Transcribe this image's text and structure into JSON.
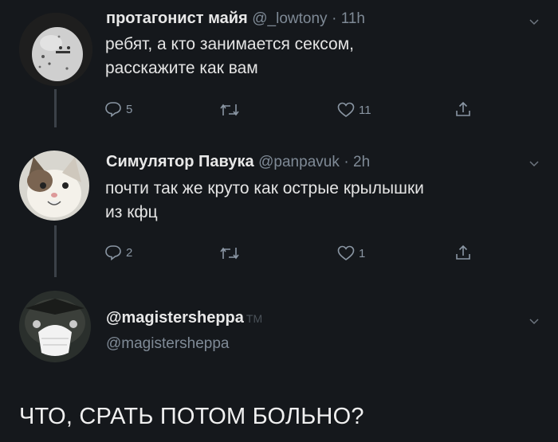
{
  "tweets": [
    {
      "name": "протагонист майя",
      "handle": "@_lowtony",
      "time": "· 11h",
      "lines": [
        "ребят, а кто занимается сексом,",
        "расскажите как вам"
      ],
      "replies": "5",
      "likes": "11"
    },
    {
      "name": "Симулятор Павука",
      "handle": "@panpavuk",
      "time": "· 2h",
      "lines": [
        "почти так же круто как острые крылышки",
        "из кфц"
      ],
      "replies": "2",
      "likes": "1"
    }
  ],
  "profile": {
    "name": "@magistersheppa",
    "tm": "TM",
    "handle": "@magistersheppa"
  },
  "reply_text": "ЧТО, СРАТЬ ПОТОМ БОЛЬНО?"
}
